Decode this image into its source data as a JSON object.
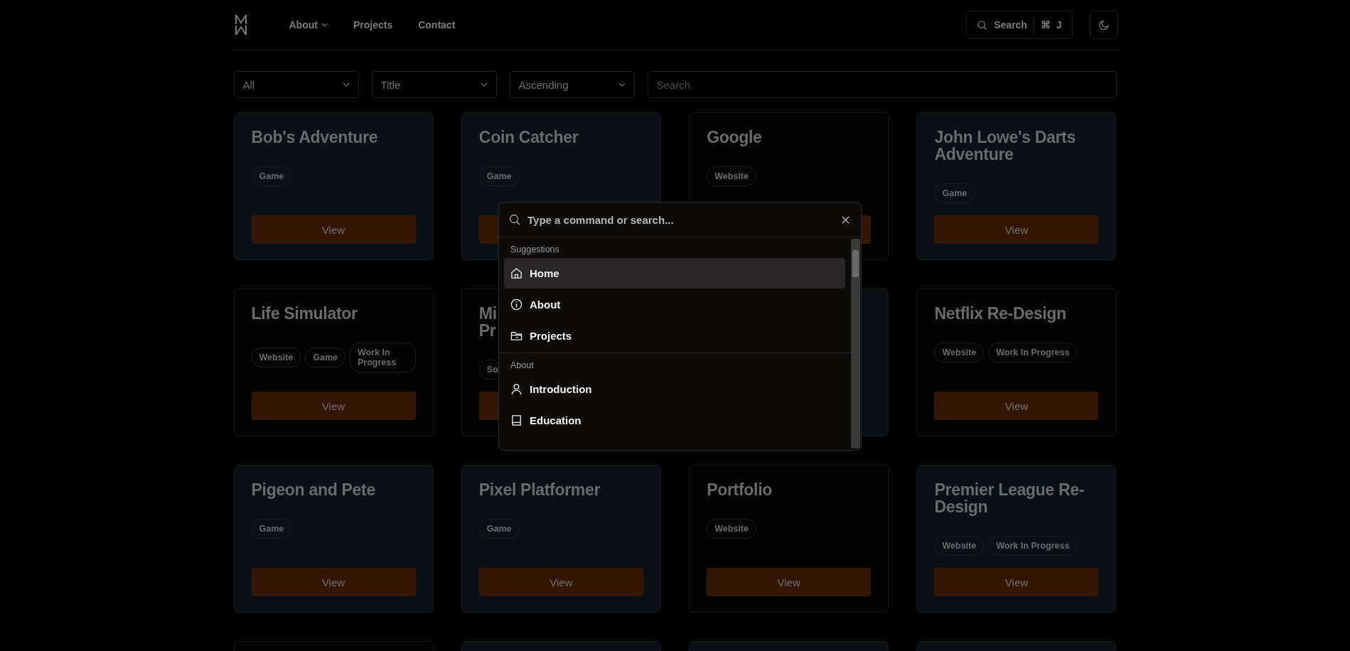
{
  "nav": {
    "links": [
      {
        "label": "About",
        "dropdown": true
      },
      {
        "label": "Projects",
        "dropdown": false
      },
      {
        "label": "Contact",
        "dropdown": false
      }
    ],
    "search": {
      "label": "Search",
      "shortcut_symbol": "⌘",
      "shortcut_key": "J"
    }
  },
  "filters": {
    "selects": [
      "All",
      "Title",
      "Ascending"
    ],
    "search": {
      "placeholder": "Search"
    }
  },
  "cards": [
    {
      "title": "Bob's Adventure",
      "tags": [
        "Game"
      ],
      "button": "View",
      "thumbnail": true
    },
    {
      "title": "Coin Catcher",
      "tags": [
        "Game"
      ],
      "thumbnail": true
    },
    {
      "title": "Google",
      "tags": [
        "Website"
      ],
      "thumbnail": false
    },
    {
      "title": "John Lowe's Darts Adventure",
      "tags": [
        "Game"
      ],
      "button": "View",
      "thumbnail": true
    },
    {
      "title": "Life Simulator",
      "tags": [
        "Website",
        "Game",
        "Work In Progress"
      ],
      "button": "View",
      "thumbnail": false
    },
    {
      "title_lines": [
        "Mi",
        "Pr"
      ],
      "tags": [
        "So"
      ],
      "thumbnail": false
    },
    {
      "thumbnail": true
    },
    {
      "title": "Netflix Re-Design",
      "tags": [
        "Website",
        "Work In Progress"
      ],
      "button": "View",
      "thumbnail": false
    },
    {
      "title": "Pigeon and Pete",
      "tags": [
        "Game"
      ],
      "button": "View",
      "thumbnail": true
    },
    {
      "title": "Pixel Platformer",
      "tags": [
        "Game"
      ],
      "button": "View",
      "thumbnail": true
    },
    {
      "title": "Portfolio",
      "tags": [
        "Website"
      ],
      "button": "View",
      "thumbnail": false
    },
    {
      "title": "Premier League Re-Design",
      "tags": [
        "Website",
        "Work In Progress"
      ],
      "button": "View",
      "thumbnail": true
    }
  ],
  "command_dialog": {
    "placeholder": "Type a command or search...",
    "groups": [
      {
        "heading": "Suggestions",
        "items": [
          {
            "label": "Home",
            "kind": "home",
            "selected": true
          },
          {
            "label": "About",
            "kind": "info",
            "selected": false
          },
          {
            "label": "Projects",
            "kind": "folder",
            "selected": false
          }
        ]
      },
      {
        "heading": "About",
        "items": [
          {
            "label": "Introduction",
            "kind": "user",
            "selected": false
          },
          {
            "label": "Education",
            "kind": "book",
            "selected": false
          }
        ]
      }
    ]
  }
}
